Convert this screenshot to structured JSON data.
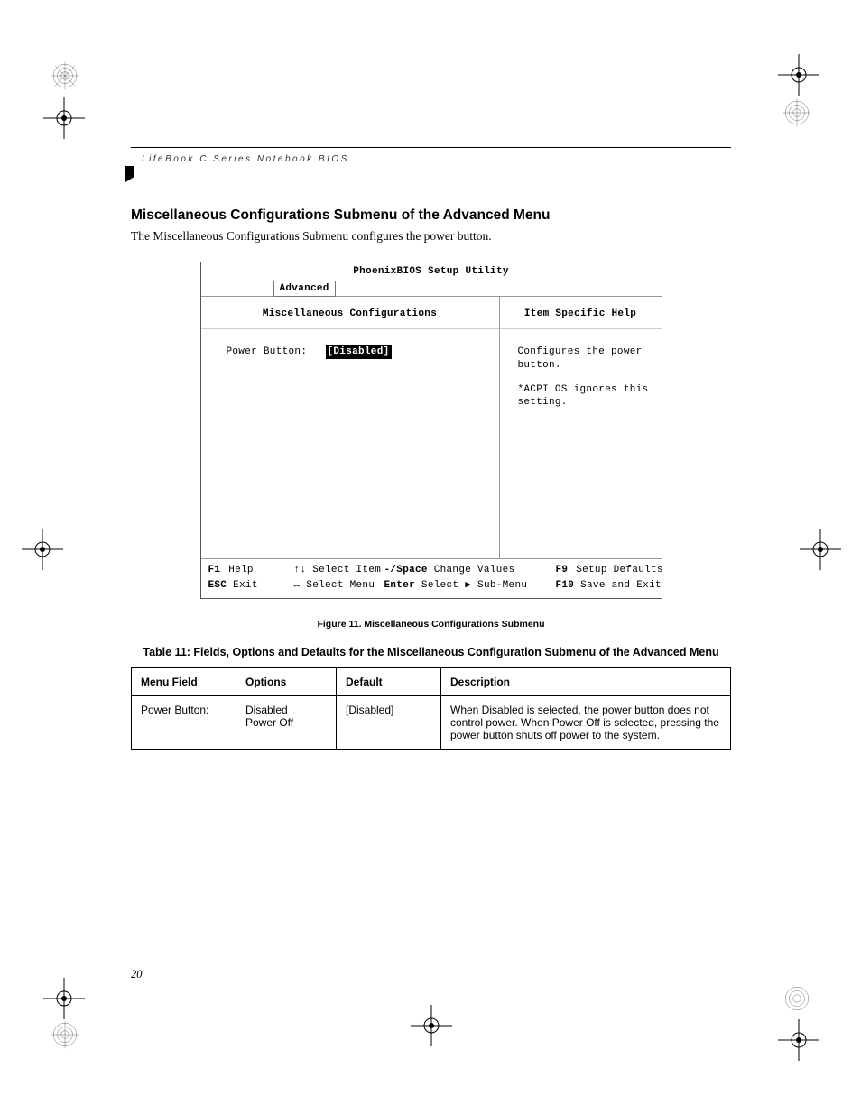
{
  "running_head": "LifeBook C Series Notebook BIOS",
  "section_title": "Miscellaneous Configurations Submenu of the Advanced Menu",
  "intro_text": "The Miscellaneous Configurations Submenu configures the power button.",
  "bios": {
    "title": "PhoenixBIOS Setup Utility",
    "active_tab": "Advanced",
    "left_heading": "Miscellaneous Configurations",
    "right_heading": "Item Specific Help",
    "field_label": "Power Button:",
    "field_value": "[Disabled]",
    "help_line1": "Configures the power button.",
    "help_line2": "*ACPI OS ignores this setting.",
    "footer": {
      "f1": "F1",
      "f1_label": "Help",
      "esc": "ESC",
      "esc_label": "Exit",
      "updn": "↑↓",
      "updn_label": "Select Item",
      "lr": "↔",
      "lr_label": "Select Menu",
      "chg_keys": "-/Space",
      "chg_label": "Change Values",
      "enter": "Enter",
      "enter_label": "Select ▶ Sub-Menu",
      "f9": "F9",
      "f9_label": "Setup Defaults",
      "f10": "F10",
      "f10_label": "Save and Exit"
    }
  },
  "figure_caption": "Figure 11.  Miscellaneous Configurations Submenu",
  "table_title": "Table 11: Fields, Options and Defaults for the Miscellaneous Configuration Submenu of the Advanced Menu",
  "table": {
    "headers": {
      "field": "Menu Field",
      "options": "Options",
      "def": "Default",
      "desc": "Description"
    },
    "rows": [
      {
        "field": "Power Button:",
        "options": "Disabled\nPower Off",
        "def": "[Disabled]",
        "desc": "When Disabled is selected, the power button does not control power. When Power Off is selected, pressing the power button shuts off power to the system."
      }
    ]
  },
  "page_number": "20"
}
